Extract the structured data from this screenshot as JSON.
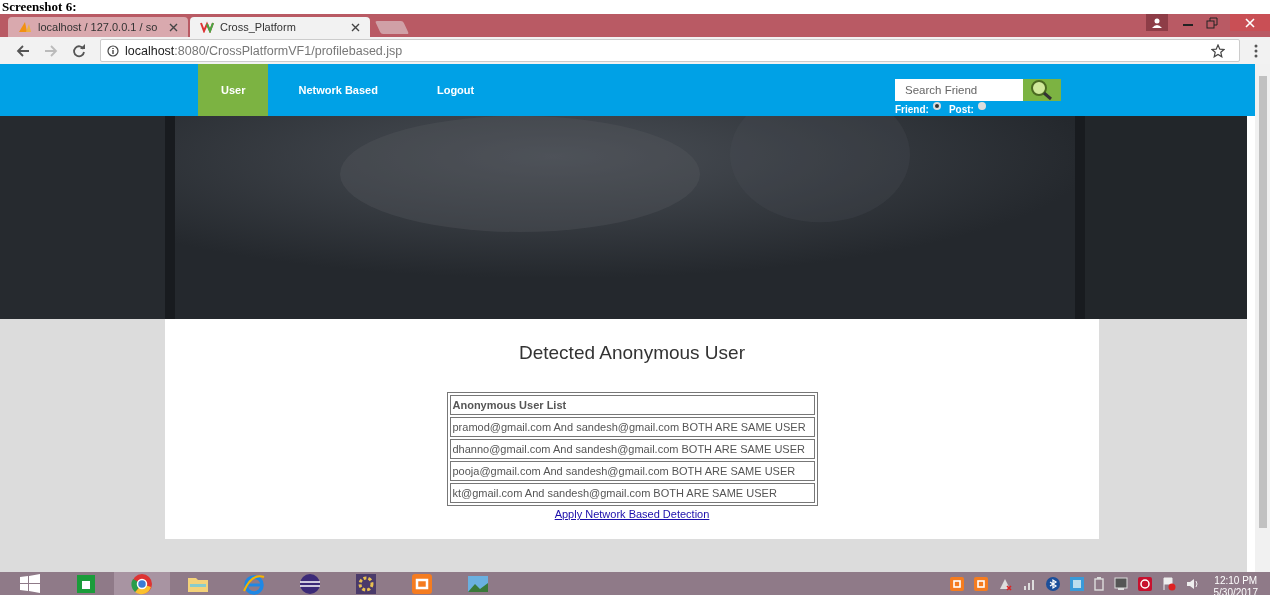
{
  "caption": "Screenshot 6:",
  "browser": {
    "tabs": [
      {
        "title": "localhost / 127.0.0.1 / so",
        "selected": false
      },
      {
        "title": "Cross_Platform",
        "selected": true
      }
    ],
    "url_host": "localhost",
    "url_path": ":8080/CrossPlatformVF1/profilebased.jsp"
  },
  "nav": {
    "items": [
      {
        "label": "User",
        "selected": true
      },
      {
        "label": "Network Based",
        "selected": false
      },
      {
        "label": "Logout",
        "selected": false
      }
    ],
    "search": {
      "placeholder": "Search Friend"
    },
    "filters": [
      {
        "label": "Friend:",
        "selected": true
      },
      {
        "label": "Post:",
        "selected": false
      }
    ]
  },
  "content": {
    "heading": "Detected Anonymous User",
    "table": {
      "header": "Anonymous User List",
      "rows": [
        "pramod@gmail.com And sandesh@gmail.com BOTH ARE SAME USER",
        "dhanno@gmail.com And sandesh@gmail.com BOTH ARE SAME USER",
        "pooja@gmail.com And sandesh@gmail.com BOTH ARE SAME USER",
        "kt@gmail.com And sandesh@gmail.com BOTH ARE SAME USER"
      ]
    },
    "link": "Apply Network Based Detection"
  },
  "taskbar": {
    "time": "12:10 PM",
    "date": "5/30/2017"
  }
}
